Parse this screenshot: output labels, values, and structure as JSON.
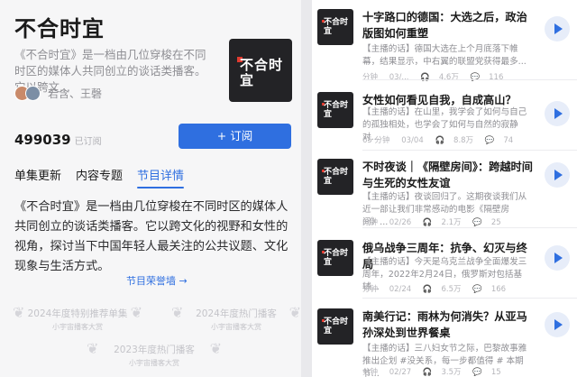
{
  "podcast": {
    "title": "不合时宜",
    "short_description": "《不合时宜》是一档由几位穿梭在不同时区的媒体人共同创立的谈话类播客。它以跨文...",
    "hosts": "若含、王磬",
    "cover_text": "不合时宜",
    "subscriber_count": "499039",
    "subscriber_label": "已订阅",
    "subscribe_button": "+ 订阅"
  },
  "tabs": [
    {
      "label": "单集更新",
      "active": false
    },
    {
      "label": "内容专题",
      "active": false
    },
    {
      "label": "节目详情",
      "active": true
    }
  ],
  "about": {
    "text": "《不合时宜》是一档由几位穿梭在不同时区的媒体人共同创立的谈话类播客。它以跨文化的视野和女性的视角，探讨当下中国年轻人最关注的公共议题、文化现象与生活方式。",
    "honors_link": "节目荣誉墙 →"
  },
  "badges": [
    {
      "title": "2024年度特别推荐单集",
      "sub": "小宇宙播客大赏"
    },
    {
      "title": "2024年度热门播客",
      "sub": "小宇宙播客大赏"
    },
    {
      "title": "2023年度热门播客",
      "sub": "小宇宙播客大赏"
    }
  ],
  "episodes": [
    {
      "title": "十字路口的德国：大选之后，政治版图如何重塑",
      "summary": "【主播的话】德国大选在上个月底落下帷幕，结果显示，中右翼的联盟党获得最多...",
      "duration": "分钟",
      "date": "03/...",
      "plays": "4.6万",
      "comments": "116"
    },
    {
      "title": "女性如何看见自我，自成高山？",
      "summary": "【主播的话】在山里，我学会了如何与自己的孤独相处，也学会了如何与自然的寂静对...",
      "duration": "65 分钟",
      "date": "03/04",
      "plays": "8.8万",
      "comments": "74"
    },
    {
      "title": "不时夜谈｜《隔壁房间》：跨越时间与生死的女性友谊",
      "summary": "【主播的话】夜谈回归了。这期夜谈我们从近一部让我们非常感动的电影《隔壁房间》...",
      "duration": "分钟",
      "date": "02/26",
      "plays": "2.1万",
      "comments": "25"
    },
    {
      "title": "俄乌战争三周年：抗争、幻灭与终局",
      "summary": "【主播的话】今天是乌克兰战争全面爆发三周年，2022年2月24日，俄罗斯对包括基辅...",
      "duration": "分钟",
      "date": "02/24",
      "plays": "6.5万",
      "comments": "166"
    },
    {
      "title": "南美行记：雨林为何消失？从亚马孙深处到世界餐桌",
      "summary": "【主播的话】三八妇女节之际，巴黎故事雅推出企划 #没关系，每一步都值得 # 本期节...",
      "duration": "分钟",
      "date": "02/27",
      "plays": "3.5万",
      "comments": "15"
    }
  ],
  "colors": {
    "accent": "#2f6fe0",
    "brand_red": "#e03b30",
    "cover_bg": "#232326"
  }
}
